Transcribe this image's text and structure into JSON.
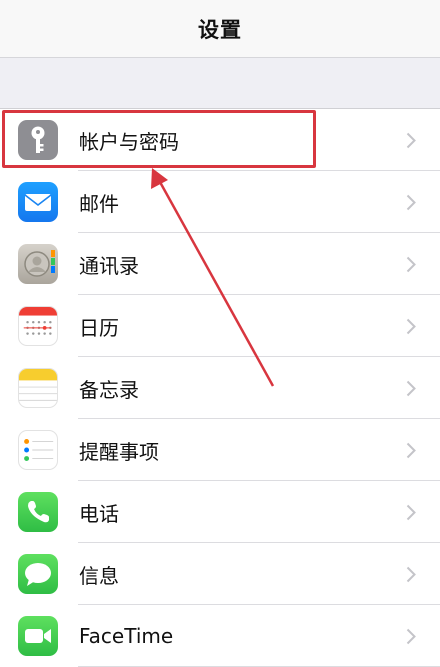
{
  "nav": {
    "title": "设置"
  },
  "rows": [
    {
      "label": "帐户与密码",
      "icon": "key-icon",
      "color": "#8e8e93"
    },
    {
      "label": "邮件",
      "icon": "mail-icon",
      "color": "#1e90f5"
    },
    {
      "label": "通讯录",
      "icon": "contacts-icon",
      "color": "#b9b5ad"
    },
    {
      "label": "日历",
      "icon": "calendar-icon",
      "color": "#ffffff"
    },
    {
      "label": "备忘录",
      "icon": "notes-icon",
      "color": "#f7cd2e"
    },
    {
      "label": "提醒事项",
      "icon": "reminders-icon",
      "color": "#ffffff"
    },
    {
      "label": "电话",
      "icon": "phone-icon",
      "color": "#34c759"
    },
    {
      "label": "信息",
      "icon": "messages-icon",
      "color": "#34c759"
    },
    {
      "label": "FaceTime",
      "icon": "facetime-icon",
      "color": "#34c759"
    }
  ],
  "annotation": {
    "color": "#d8363f"
  }
}
